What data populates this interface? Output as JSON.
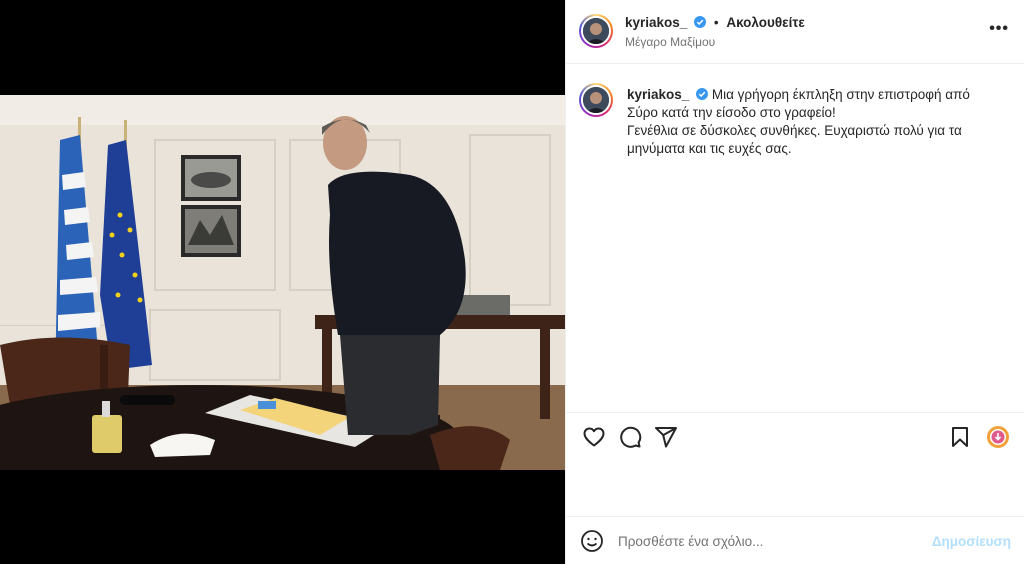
{
  "post": {
    "username": "kyriakos_",
    "follow_status": "Ακολουθείτε",
    "location": "Μέγαρο Μαξίμου",
    "more_icon": "more-options-icon",
    "caption_line1": "Μια γρήγορη έκπληξη στην επιστροφή από Σύρο κατά την είσοδο στο γραφείο!",
    "caption_line2": "Γενέθλια σε δύσκολες συνθήκες. Ευχαριστώ πολύ για τα μηνύματα και τις ευχές σας."
  },
  "actions": {
    "like_icon": "heart-icon",
    "comment_icon": "comment-icon",
    "share_icon": "send-icon",
    "save_icon": "bookmark-icon",
    "extension_icon": "download-extension-icon"
  },
  "comment": {
    "placeholder": "Προσθέστε ένα σχόλιο...",
    "post_label": "Δημοσίευση",
    "emoji_icon": "emoji-icon"
  },
  "colors": {
    "verified": "#3897f0",
    "post_button_disabled": "#b2dffc",
    "border": "#efefef",
    "muted_text": "#737373"
  }
}
